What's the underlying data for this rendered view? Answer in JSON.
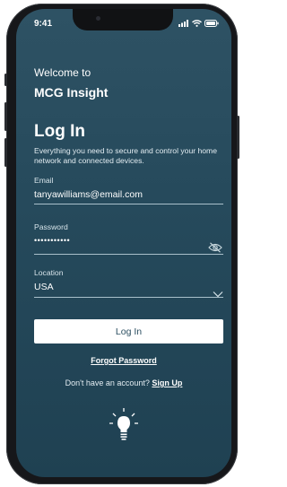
{
  "status_bar": {
    "time": "9:41"
  },
  "header": {
    "welcome": "Welcome to",
    "brand": "MCG Insight"
  },
  "login": {
    "title": "Log In",
    "description": "Everything you need to secure and control your home network and connected devices."
  },
  "form": {
    "email_label": "Email",
    "email_value": "tanyawilliams@email.com",
    "password_label": "Password",
    "password_value": "•••••••••••",
    "location_label": "Location",
    "location_value": "USA",
    "submit_label": "Log In"
  },
  "links": {
    "forgot_password": "Forgot Password",
    "no_account": "Don't have an account?",
    "sign_up": "Sign Up"
  },
  "icons": {
    "password_visibility": "eye-off-icon",
    "location_dropdown": "chevron-down-icon",
    "footer": "lightbulb-icon"
  }
}
